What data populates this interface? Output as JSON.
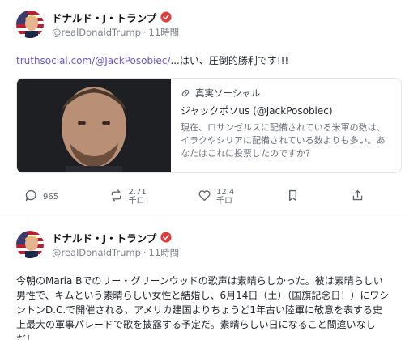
{
  "posts": [
    {
      "author": {
        "display_name": "ドナルド・J・トランプ",
        "handle": "@realDonaldTrump",
        "separator": "·",
        "time": "11時間"
      },
      "text_link": "truthsocial.com/@JackPosobiec/",
      "text_rest": "...はい、圧倒的勝利です!!!",
      "card": {
        "source": "真実ソーシャル",
        "title": "ジャックポソus (@JackPosobiec)",
        "description": "現在、ロサンゼルスに配備されている米軍の数は、イラクやシリアに配備されている数よりも多い。あなたはこれに投票したのですか？"
      },
      "actions": {
        "reply": "965",
        "repost_value": "2.71",
        "repost_unit": "千ロ",
        "like_value": "12.4",
        "like_unit": "千ロ"
      }
    },
    {
      "author": {
        "display_name": "ドナルド・J・トランプ",
        "handle": "@realDonaldTrump",
        "separator": "·",
        "time": "11時間"
      },
      "text": "今朝のMaria Bでのリー・グリーンウッドの歌声は素晴らしかった。彼は素晴らしい男性で、キムという素晴らしい女性と結婚し、6月14日（土）（国旗記念日！）にワシントンD.C.で開催される、アメリカ建国よりちょうど1年古い陸軍に敬意を表する史上最大の軍事パレードで歌を披露する予定だ。素晴らしい日になること間違いなしだ！"
    }
  ],
  "colors": {
    "link": "#6a5acd",
    "verified": "#e23b3b",
    "muted": "#7b7f86"
  }
}
